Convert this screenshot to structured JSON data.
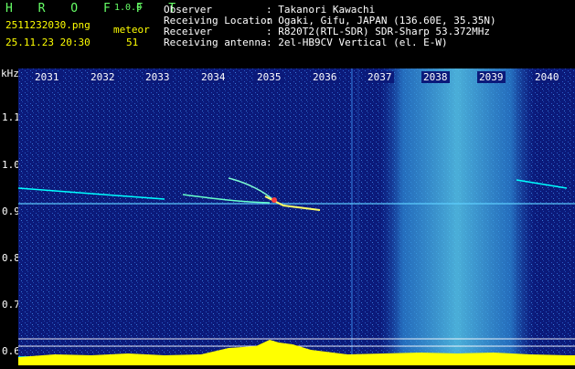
{
  "app": {
    "title": "H R O F F T",
    "version": "1.0.0",
    "filename": "2511232030.png",
    "datetime": "25.11.23 20:30",
    "mode_label": "meteor",
    "count": "51"
  },
  "info": {
    "observer_label": "Observer",
    "observer_value": ": Takanori Kawachi",
    "location_label": "Receiving Location",
    "location_value": ": Ogaki, Gifu, JAPAN (136.60E, 35.35N)",
    "receiver_label": "Receiver",
    "receiver_value": ": R820T2(RTL-SDR) SDR-Sharp 53.372MHz",
    "antenna_label": "Receiving antenna",
    "antenna_value": ": 2el-HB9CV Vertical (el. E-W)"
  },
  "axis": {
    "unit": "kHz",
    "freq_ticks": [
      "1.1",
      "1.0",
      "0.9",
      "0.8",
      "0.7",
      "0.6"
    ],
    "time_ticks": [
      "2031",
      "2032",
      "2033",
      "2034",
      "2035",
      "2036",
      "2037",
      "2038",
      "2039",
      "2040"
    ]
  },
  "colors": {
    "background": "#0b1a7a",
    "header_text": "#ffff00",
    "title": "#66ff66",
    "signal": "#00ffff",
    "level_bar": "#ffff00"
  }
}
